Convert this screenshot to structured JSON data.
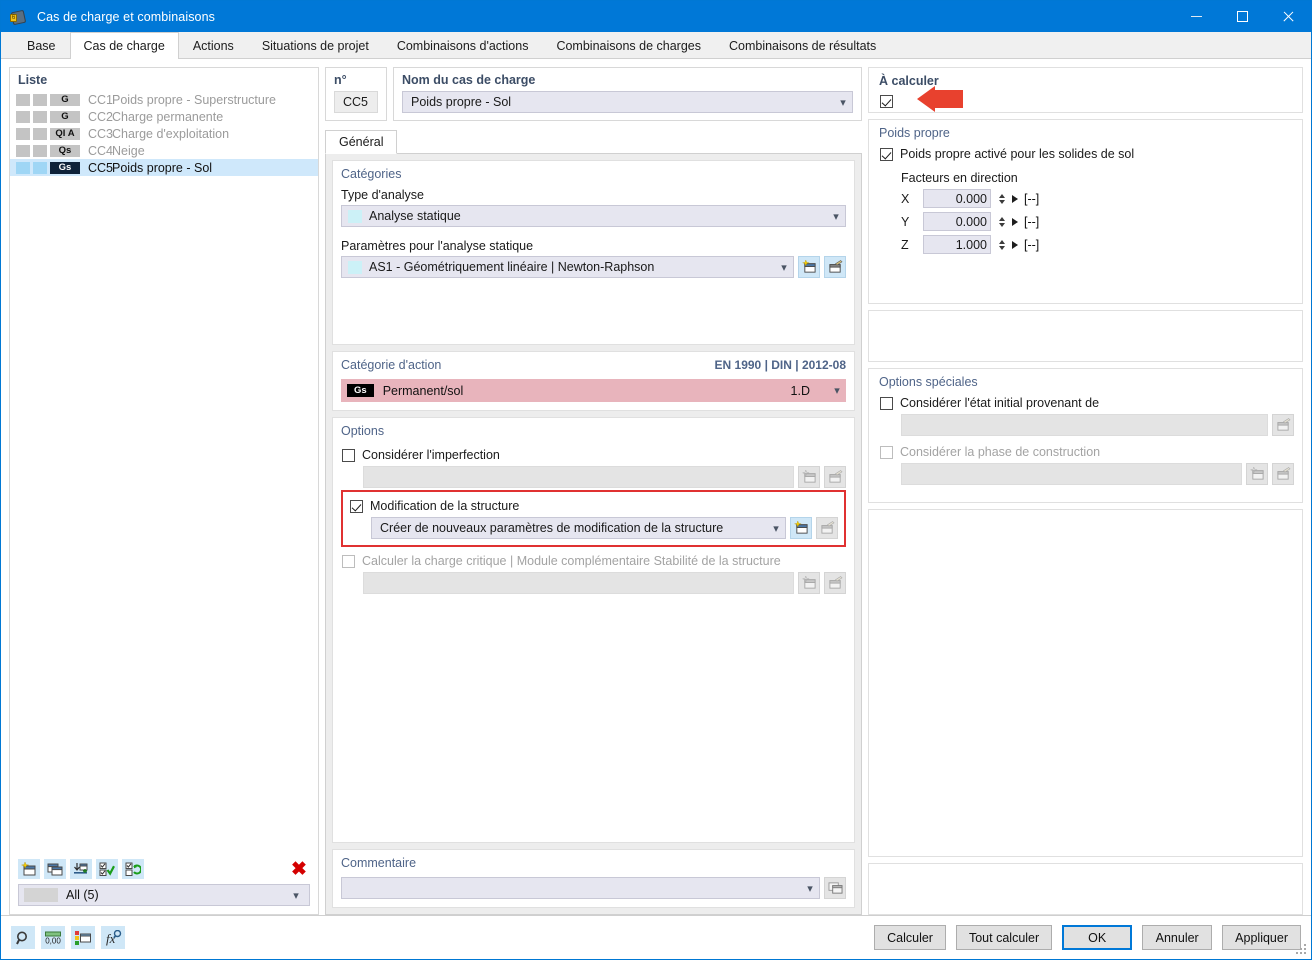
{
  "window": {
    "title": "Cas de charge et combinaisons",
    "icon": "app-load-case-icon",
    "minimize": "minimize-icon",
    "maximize": "maximize-icon",
    "close": "close-icon"
  },
  "tabs": [
    {
      "label": "Base",
      "active": false
    },
    {
      "label": "Cas de charge",
      "active": true
    },
    {
      "label": "Actions",
      "active": false
    },
    {
      "label": "Situations de projet",
      "active": false
    },
    {
      "label": "Combinaisons d'actions",
      "active": false
    },
    {
      "label": "Combinaisons de charges",
      "active": false
    },
    {
      "label": "Combinaisons de résultats",
      "active": false
    }
  ],
  "list": {
    "title": "Liste",
    "rows": [
      {
        "tag": "G",
        "no": "CC1",
        "name": "Poids propre - Superstructure",
        "selected": false
      },
      {
        "tag": "G",
        "no": "CC2",
        "name": "Charge permanente",
        "selected": false
      },
      {
        "tag": "QI A",
        "no": "CC3",
        "name": "Charge d'exploitation",
        "selected": false
      },
      {
        "tag": "Qs",
        "no": "CC4",
        "name": "Neige",
        "selected": false
      },
      {
        "tag": "Gs",
        "no": "CC5",
        "name": "Poids propre - Sol",
        "selected": true
      }
    ],
    "toolbar": [
      "new-load-case-icon",
      "copy-load-case-icon",
      "import-load-case-icon",
      "select-all-icon",
      "invert-selection-icon",
      "delete-icon"
    ],
    "filter": {
      "value": "All (5)",
      "chevron": "chevron-down-icon"
    }
  },
  "header": {
    "number_label": "n°",
    "number_value": "CC5",
    "name_label": "Nom du cas de charge",
    "name_value": "Poids propre - Sol",
    "name_chevron": "chevron-down-icon"
  },
  "to_calculate": {
    "title": "À calculer",
    "checked": true,
    "annotation": "red-arrow-annotation"
  },
  "subtabs": [
    {
      "label": "Général",
      "active": true
    }
  ],
  "categories": {
    "title": "Catégories",
    "analysis_type_label": "Type d'analyse",
    "analysis_type_value": "Analyse statique",
    "params_label": "Paramètres pour l'analyse statique",
    "params_value": "AS1 - Géométriquement linéaire | Newton-Raphson",
    "new_icon": "new-item-icon",
    "edit_icon": "edit-item-icon"
  },
  "action_category": {
    "title": "Catégorie d'action",
    "standard": "EN 1990 | DIN | 2012-08",
    "tag": "Gs",
    "value": "Permanent/sol",
    "code": "1.D",
    "chevron": "chevron-down-icon",
    "row_color": "#e8b4bc"
  },
  "options": {
    "title": "Options",
    "imperfection": {
      "label": "Considérer l'imperfection",
      "checked": false,
      "field_value": "",
      "new_icon": "new-item-icon",
      "edit_icon": "edit-item-icon"
    },
    "structure_modification": {
      "label": "Modification de la structure",
      "checked": true,
      "field_value": "Créer de nouveaux paramètres de modification de la structure",
      "chevron": "chevron-down-icon",
      "new_icon": "new-item-icon",
      "edit_icon": "edit-item-icon",
      "highlight_color": "#e03131"
    },
    "critical_load": {
      "label": "Calculer la charge critique | Module complémentaire Stabilité de la structure",
      "checked": false,
      "enabled": false,
      "field_value": "",
      "new_icon": "new-item-icon",
      "edit_icon": "edit-item-icon"
    }
  },
  "comment": {
    "title": "Commentaire",
    "value": "",
    "chevron": "chevron-down-icon",
    "copy_icon": "copy-comment-icon"
  },
  "self_weight": {
    "title": "Poids propre",
    "enabled_label": "Poids propre activé pour les solides de sol",
    "enabled_checked": true,
    "factors_label": "Facteurs en direction",
    "factors": [
      {
        "axis": "X",
        "value": "0.000",
        "unit": "[--]"
      },
      {
        "axis": "Y",
        "value": "0.000",
        "unit": "[--]"
      },
      {
        "axis": "Z",
        "value": "1.000",
        "unit": "[--]"
      }
    ]
  },
  "special_options": {
    "title": "Options spéciales",
    "initial_state": {
      "label": "Considérer l'état initial provenant de",
      "checked": false,
      "field_value": "",
      "edit_icon": "edit-item-icon"
    },
    "construction_phase": {
      "label": "Considérer la phase de construction",
      "checked": false,
      "enabled": false,
      "field_value": "",
      "new_icon": "new-item-icon",
      "edit_icon": "edit-item-icon"
    }
  },
  "bottom": {
    "tools": [
      "search-icon",
      "decimals-icon",
      "units-icon",
      "formula-icon"
    ],
    "buttons": [
      {
        "label": "Calculer",
        "default": false
      },
      {
        "label": "Tout calculer",
        "default": false
      },
      {
        "label": "OK",
        "default": true
      },
      {
        "label": "Annuler",
        "default": false
      },
      {
        "label": "Appliquer",
        "default": false
      }
    ]
  }
}
